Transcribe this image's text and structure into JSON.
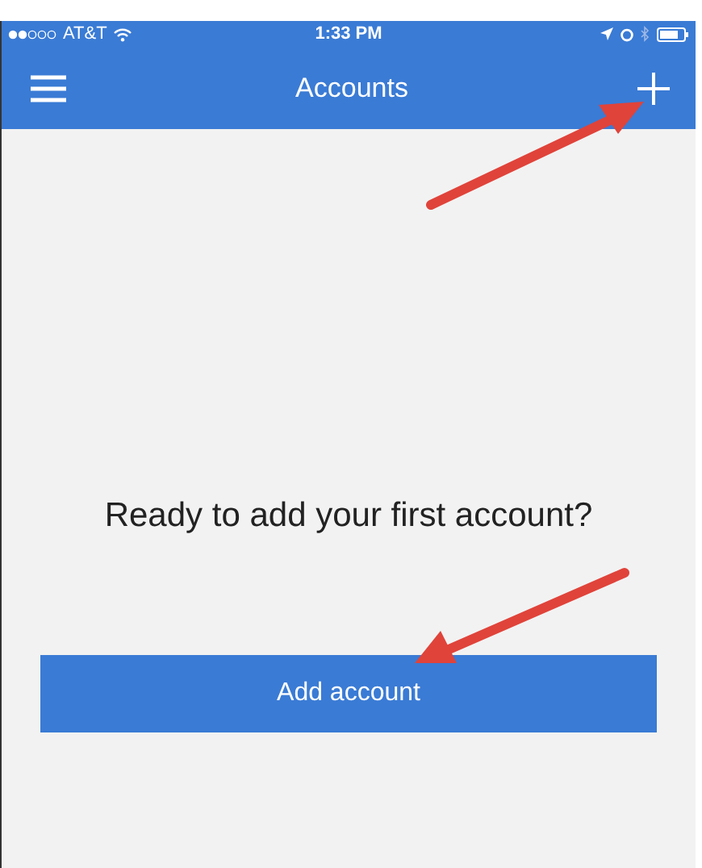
{
  "status_bar": {
    "carrier": "AT&T",
    "time": "1:33 PM"
  },
  "nav_bar": {
    "title": "Accounts"
  },
  "empty_state": {
    "message": "Ready to add your first account?",
    "button": "Add account"
  }
}
